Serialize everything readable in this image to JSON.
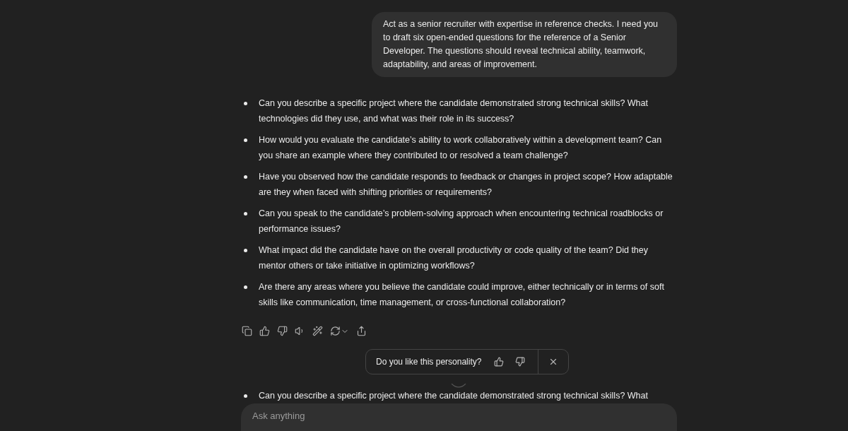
{
  "user_message": "Act as a senior recruiter with expertise in reference checks. I need you to draft six open-ended questions for the reference of a Senior Developer. The questions should reveal technical ability, teamwork, adaptability, and areas of improvement.",
  "answer": [
    "Can you describe a specific project where the candidate demonstrated strong technical skills? What technologies did they use, and what was their role in its success?",
    "How would you evaluate the candidate’s ability to work collaboratively within a development team? Can you share an example where they contributed to or resolved a team challenge?",
    "Have you observed how the candidate responds to feedback or changes in project scope? How adaptable are they when faced with shifting priorities or requirements?",
    "Can you speak to the candidate’s problem-solving approach when encountering technical roadblocks or performance issues?",
    "What impact did the candidate have on the overall productivity or code quality of the team? Did they mentor others or take initiative in optimizing workflows?",
    "Are there any areas where you believe the candidate could improve, either technically or in terms of soft skills like communication, time management, or cross-functional collaboration?"
  ],
  "feedback_prompt": {
    "question": "Do you like this personality?"
  },
  "second_answer": [
    "Can you describe a specific project where the candidate demonstrated strong technical skills? What"
  ],
  "composer": {
    "placeholder": "Ask anything"
  }
}
